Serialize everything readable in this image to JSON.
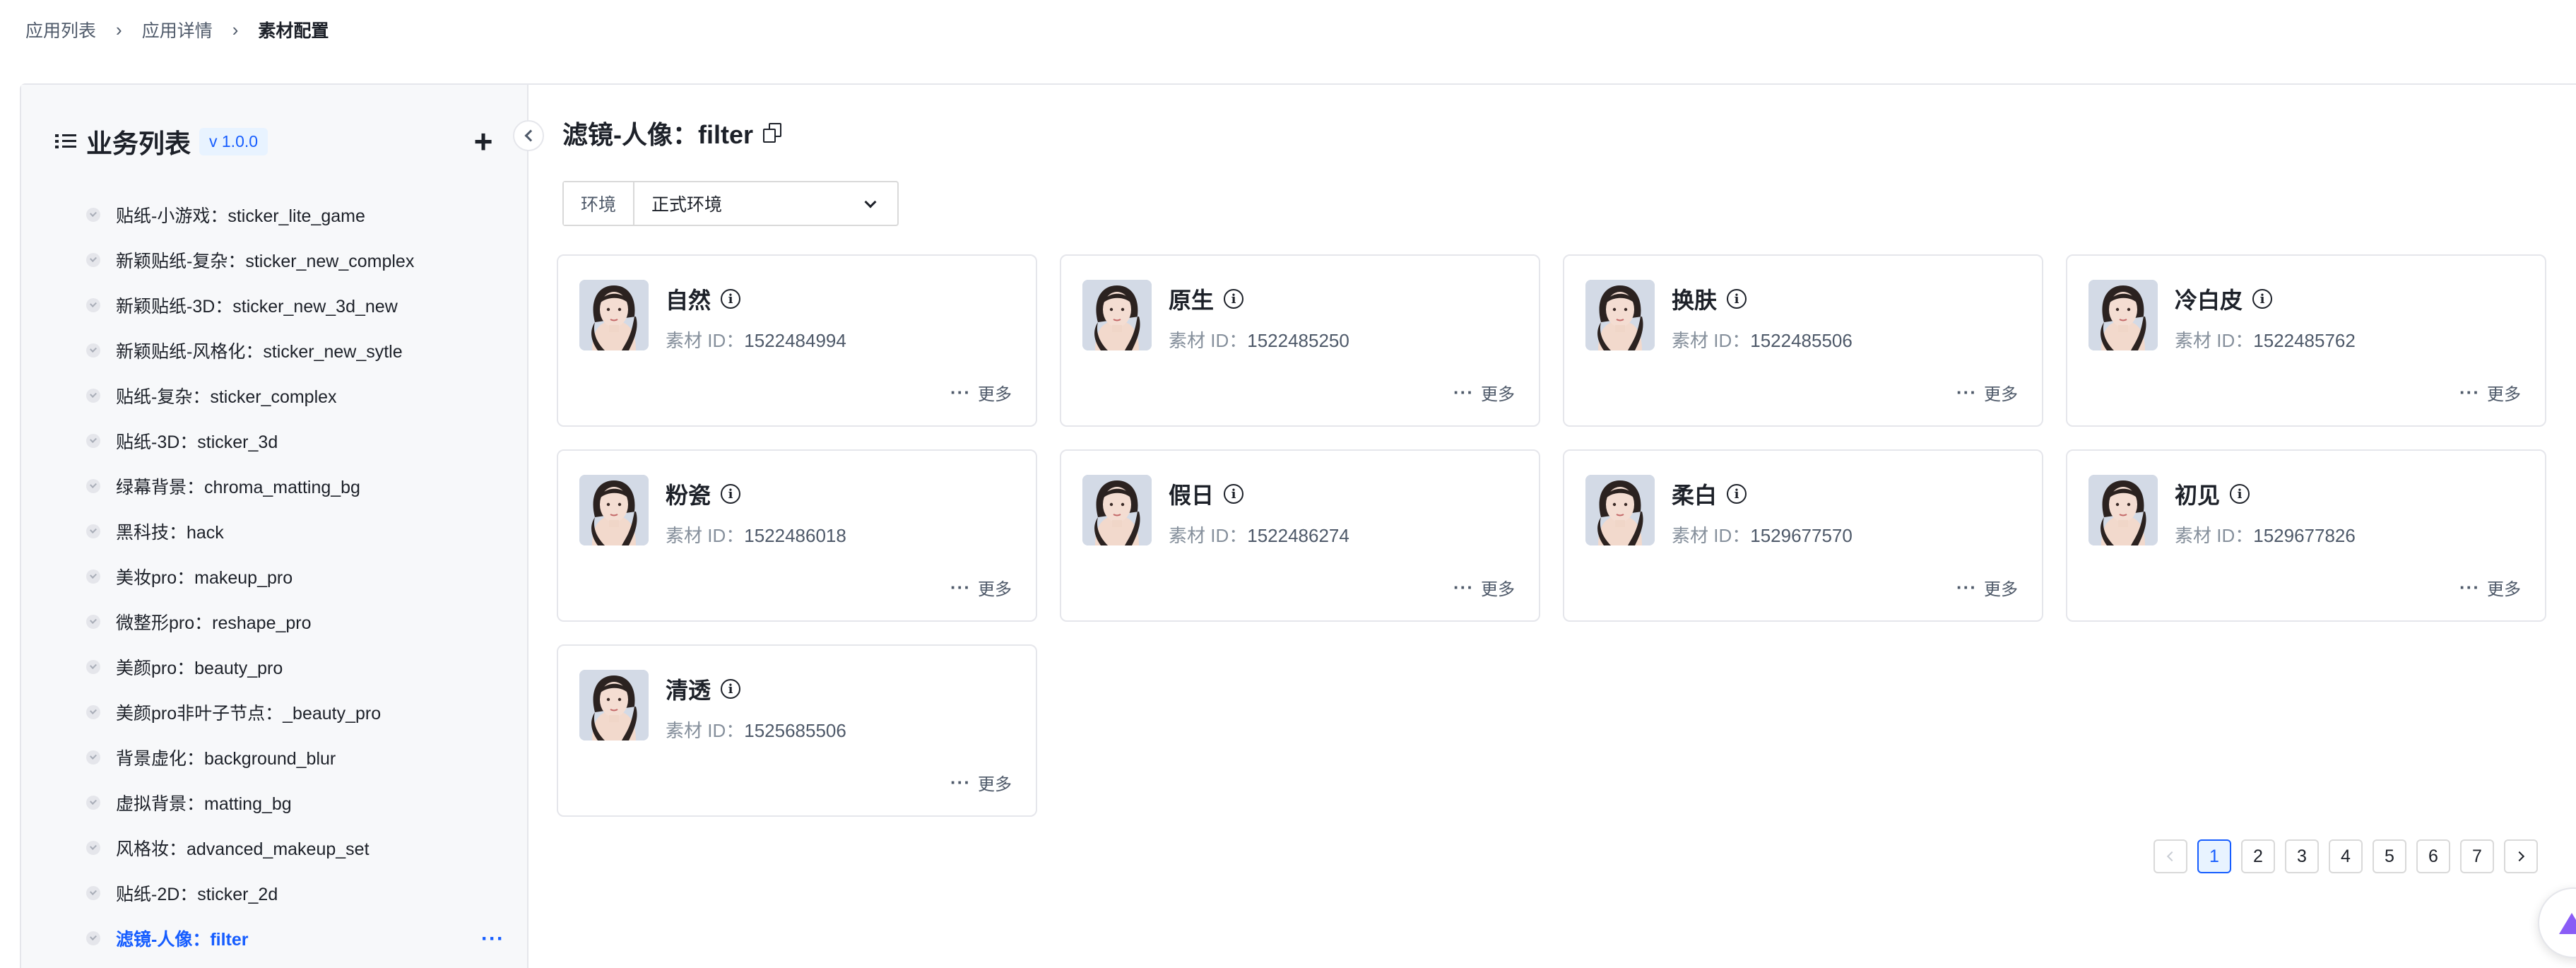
{
  "breadcrumb": {
    "items": [
      "应用列表",
      "应用详情",
      "素材配置"
    ],
    "separator": "›"
  },
  "sidebar": {
    "title": "业务列表",
    "version": "v 1.0.0",
    "add_label": "+",
    "items": [
      {
        "label": "贴纸-小游戏：sticker_lite_game",
        "active": false
      },
      {
        "label": "新颖贴纸-复杂：sticker_new_complex",
        "active": false
      },
      {
        "label": "新颖贴纸-3D：sticker_new_3d_new",
        "active": false
      },
      {
        "label": "新颖贴纸-风格化：sticker_new_sytle",
        "active": false
      },
      {
        "label": "贴纸-复杂：sticker_complex",
        "active": false
      },
      {
        "label": "贴纸-3D：sticker_3d",
        "active": false
      },
      {
        "label": "绿幕背景：chroma_matting_bg",
        "active": false
      },
      {
        "label": "黑科技：hack",
        "active": false
      },
      {
        "label": "美妆pro：makeup_pro",
        "active": false
      },
      {
        "label": "微整形pro：reshape_pro",
        "active": false
      },
      {
        "label": "美颜pro：beauty_pro",
        "active": false
      },
      {
        "label": "美颜pro非叶子节点：_beauty_pro",
        "active": false
      },
      {
        "label": "背景虚化：background_blur",
        "active": false
      },
      {
        "label": "虚拟背景：matting_bg",
        "active": false
      },
      {
        "label": "风格妆：advanced_makeup_set",
        "active": false
      },
      {
        "label": "贴纸-2D：sticker_2d",
        "active": false
      },
      {
        "label": "滤镜-人像：filter",
        "active": true,
        "more": "···"
      }
    ]
  },
  "main": {
    "title": "滤镜-人像：filter",
    "env_label": "环境",
    "env_value": "正式环境",
    "id_label": "素材 ID：",
    "more_label": "更多",
    "more_dots": "···",
    "info_glyph": "i",
    "cards": [
      {
        "name": "自然",
        "id": "1522484994"
      },
      {
        "name": "原生",
        "id": "1522485250"
      },
      {
        "name": "换肤",
        "id": "1522485506"
      },
      {
        "name": "冷白皮",
        "id": "1522485762"
      },
      {
        "name": "粉瓷",
        "id": "1522486018"
      },
      {
        "name": "假日",
        "id": "1522486274"
      },
      {
        "name": "柔白",
        "id": "1529677570"
      },
      {
        "name": "初见",
        "id": "1529677826"
      },
      {
        "name": "清透",
        "id": "1525685506"
      }
    ]
  },
  "pagination": {
    "pages": [
      "1",
      "2",
      "3",
      "4",
      "5",
      "6",
      "7"
    ],
    "current": "1"
  },
  "colors": {
    "accent": "#165dff",
    "sidebar_bg": "#f7f8fa",
    "border": "#e5e6eb"
  },
  "icons": [
    "list-icon",
    "plus-icon",
    "chevron-left-icon",
    "copy-icon",
    "chevron-down-icon",
    "info-icon",
    "more-dots-icon",
    "check-circle-icon",
    "arrow-left-icon",
    "arrow-right-icon",
    "assistant-icon"
  ]
}
